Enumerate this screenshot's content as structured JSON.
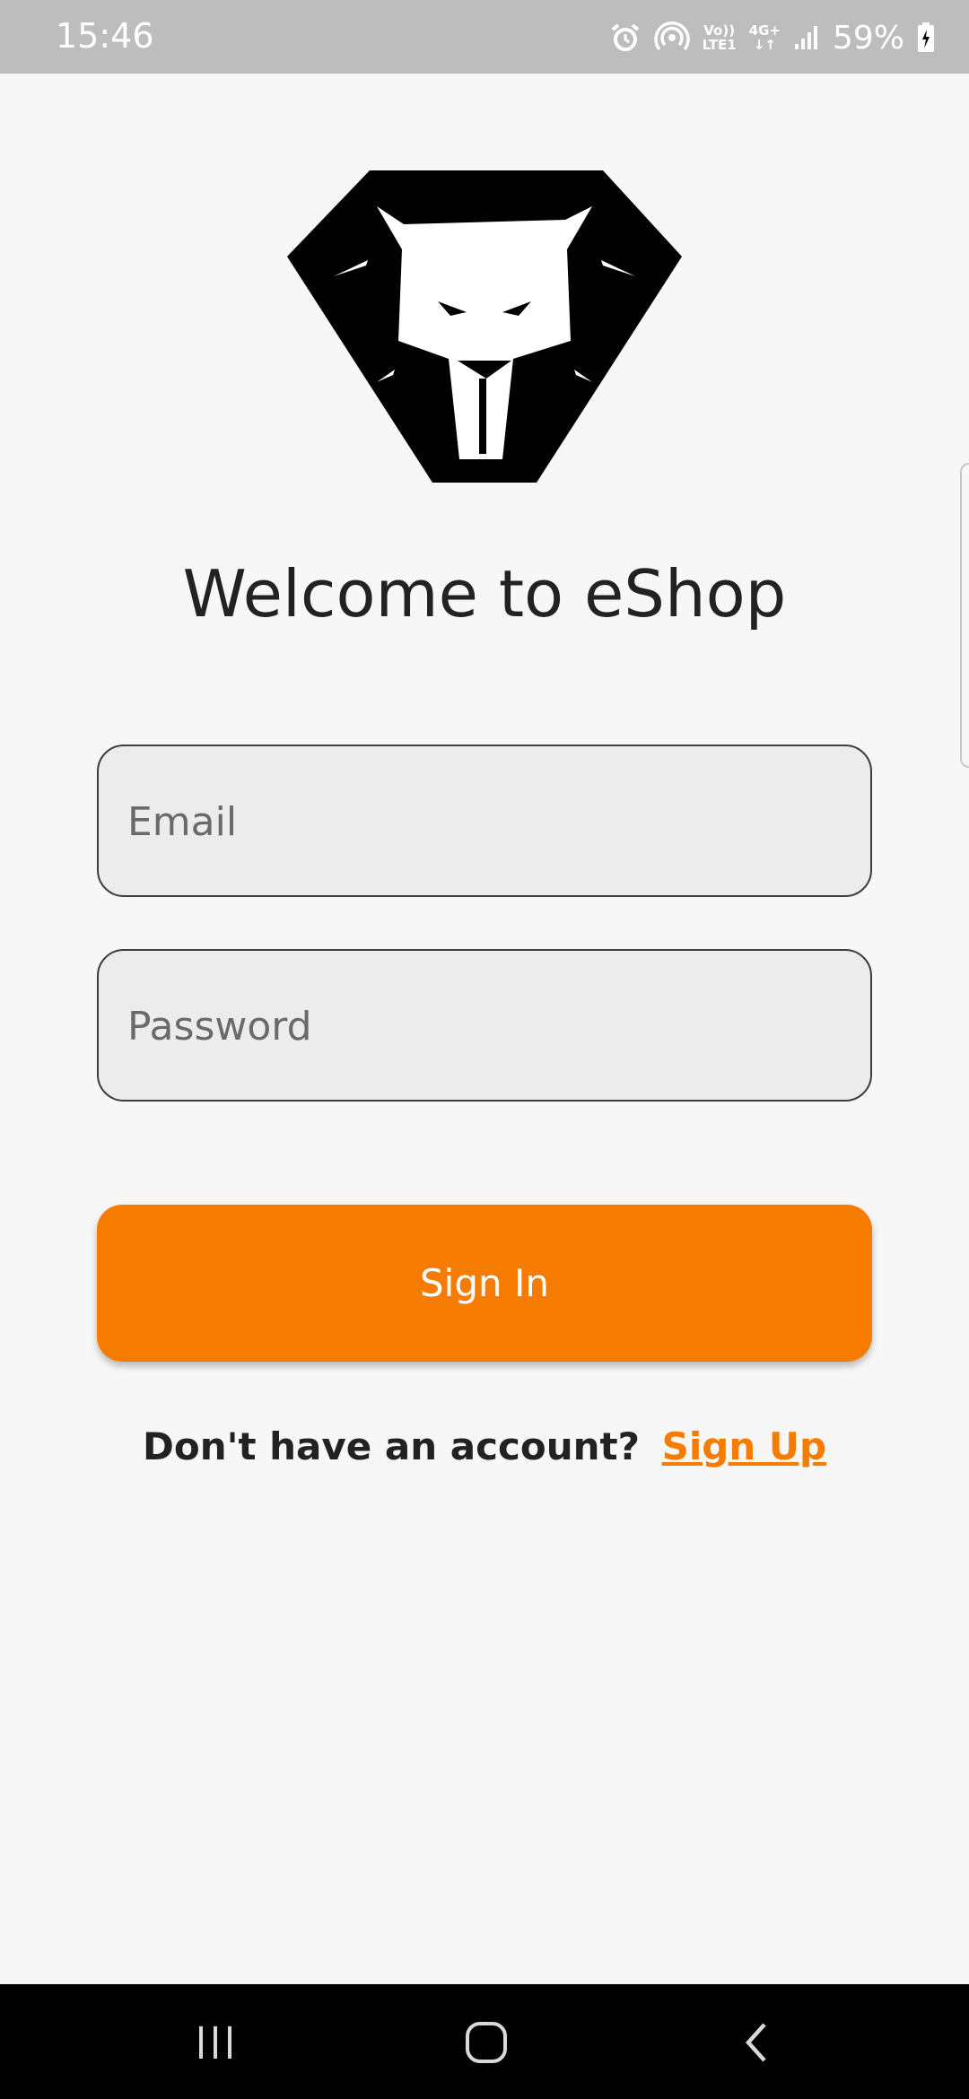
{
  "status_bar": {
    "time": "15:46",
    "network_top": "Vo))",
    "network_bottom": "LTE1",
    "data_type": "4G+",
    "battery": "59%",
    "icons": [
      "alarm-icon",
      "hotspot-icon",
      "volte-icon",
      "data-arrows-icon",
      "signal-icon",
      "battery-icon"
    ]
  },
  "logo": {
    "icon": "lion-logo"
  },
  "welcome": {
    "title": "Welcome to eShop"
  },
  "form": {
    "email_placeholder": "Email",
    "email_value": "",
    "password_placeholder": "Password",
    "password_value": "",
    "signin_label": "Sign In"
  },
  "signup": {
    "prompt": "Don't have an account?",
    "link": "Sign Up"
  },
  "nav_bar": {
    "icons": [
      "recents-icon",
      "home-icon",
      "back-icon"
    ]
  },
  "colors": {
    "accent": "#f57c00",
    "status_bar": "#bdbdbd",
    "background": "#f7f7f7",
    "field_background": "#ececec",
    "nav_bar": "#000000"
  }
}
